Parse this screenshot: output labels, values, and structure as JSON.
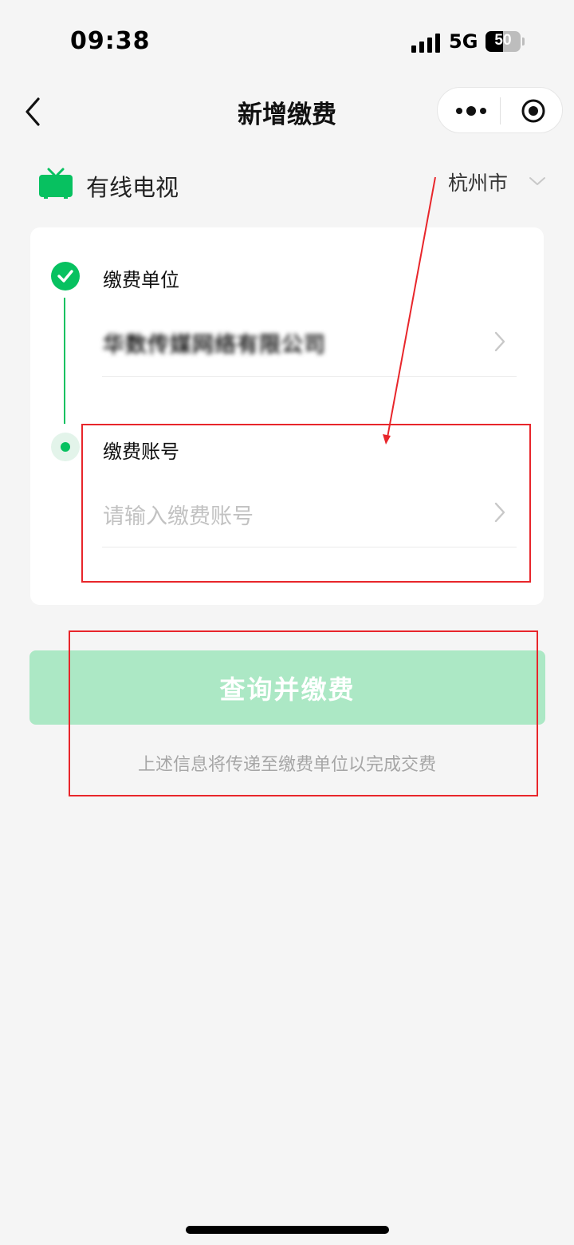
{
  "status_bar": {
    "time": "09:38",
    "network": "5G",
    "battery": "50",
    "battery_level": 0.5
  },
  "nav": {
    "title": "新增缴费",
    "back_icon": "chevron-left-icon",
    "more_icon": "more-dots-icon",
    "close_icon": "target-circle-icon"
  },
  "service": {
    "icon": "tv-icon",
    "name": "有线电视",
    "city": "杭州市"
  },
  "steps": [
    {
      "label": "缴费单位",
      "value": "华数传媒网络有限公司",
      "state": "done"
    },
    {
      "label": "缴费账号",
      "placeholder": "请输入缴费账号",
      "state": "active"
    }
  ],
  "actions": {
    "submit_label": "查询并缴费",
    "hint": "上述信息将传递至缴费单位以完成交费"
  },
  "colors": {
    "accent": "#07c160",
    "button_disabled": "#ace8c5",
    "annotation": "#e8262b"
  }
}
